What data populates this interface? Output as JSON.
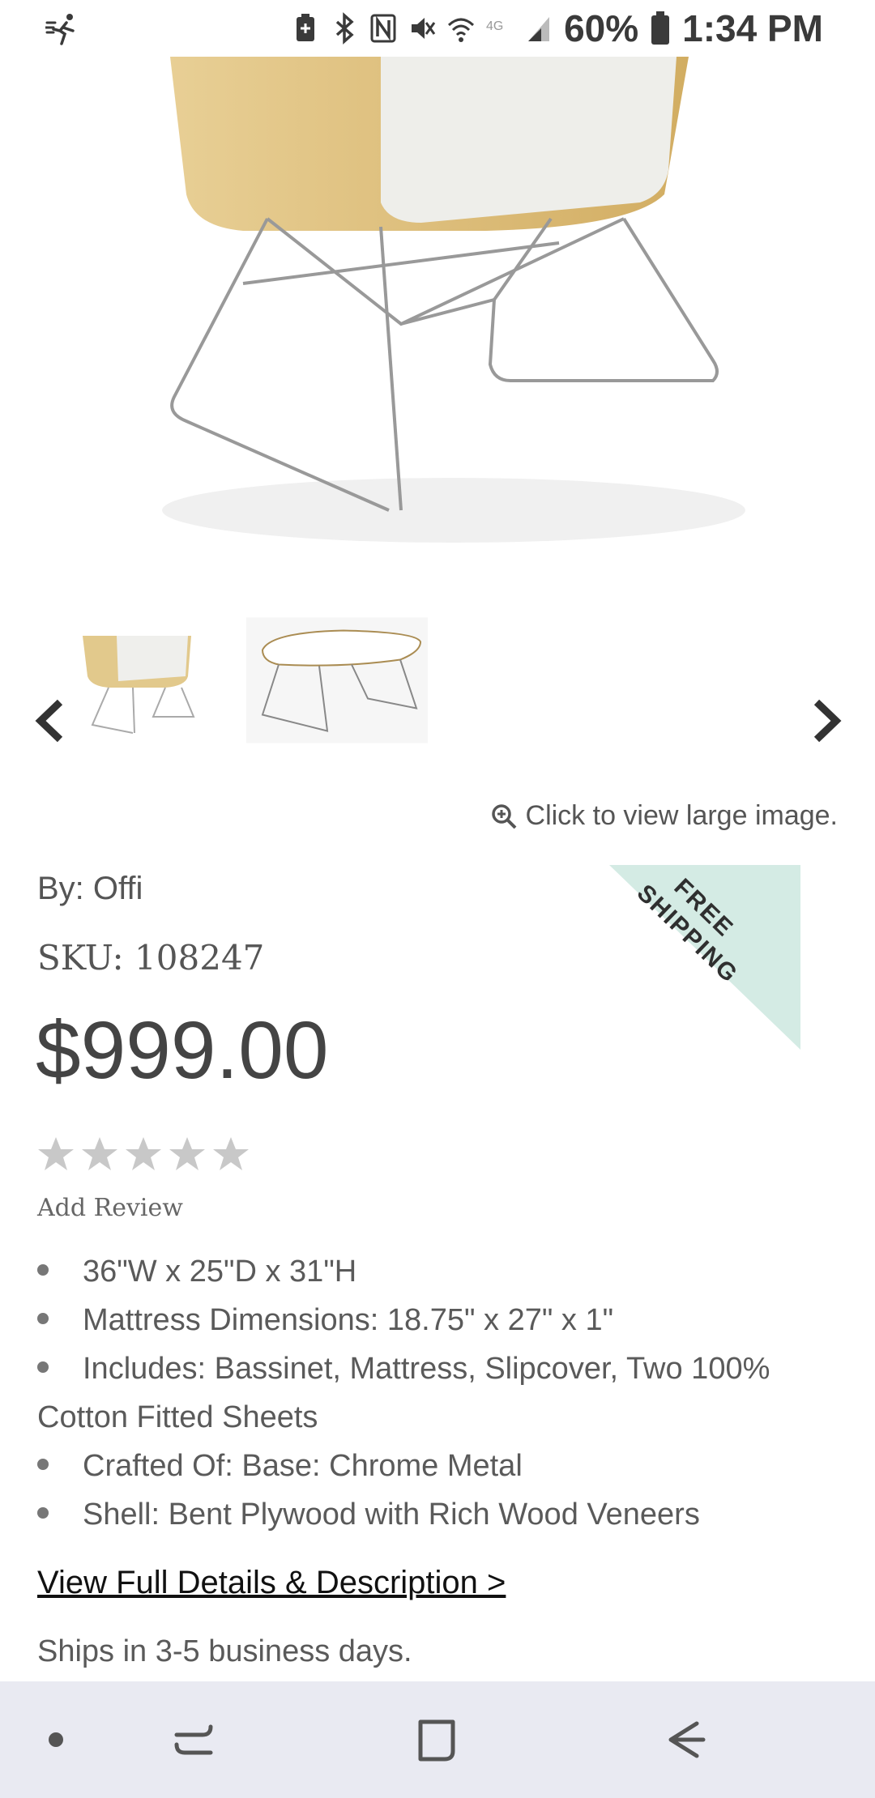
{
  "status_bar": {
    "icons": [
      "activity-icon",
      "battery-saver-icon",
      "bluetooth-icon",
      "nfc-icon",
      "mute-icon",
      "wifi-icon",
      "lte-icon",
      "signal-icon"
    ],
    "battery_percent": "60%",
    "time": "1:34 PM"
  },
  "product": {
    "zoom_text": "Click to view large image.",
    "by": "By: Offi",
    "sku": "SKU: 108247",
    "price": "$999.00",
    "ribbon": [
      "FREE",
      "SHIPPING"
    ],
    "rating": 0,
    "add_review": "Add Review",
    "features": [
      "36\"W x 25\"D x 31\"H",
      "Mattress Dimensions: 18.75\" x 27\" x 1\"",
      "Includes: Bassinet, Mattress, Slipcover, Two 100% Cotton Fitted Sheets",
      "Crafted Of: Base: Chrome Metal",
      "Shell: Bent Plywood with Rich Wood Veneers"
    ],
    "details_link": "View Full Details & Description >",
    "shipping_note": "Ships in 3-5 business days."
  },
  "colors": {
    "ribbon_bg": "#d4ebe4",
    "star_empty": "#c8c8c8",
    "nav_bg": "#e9eaf2"
  }
}
